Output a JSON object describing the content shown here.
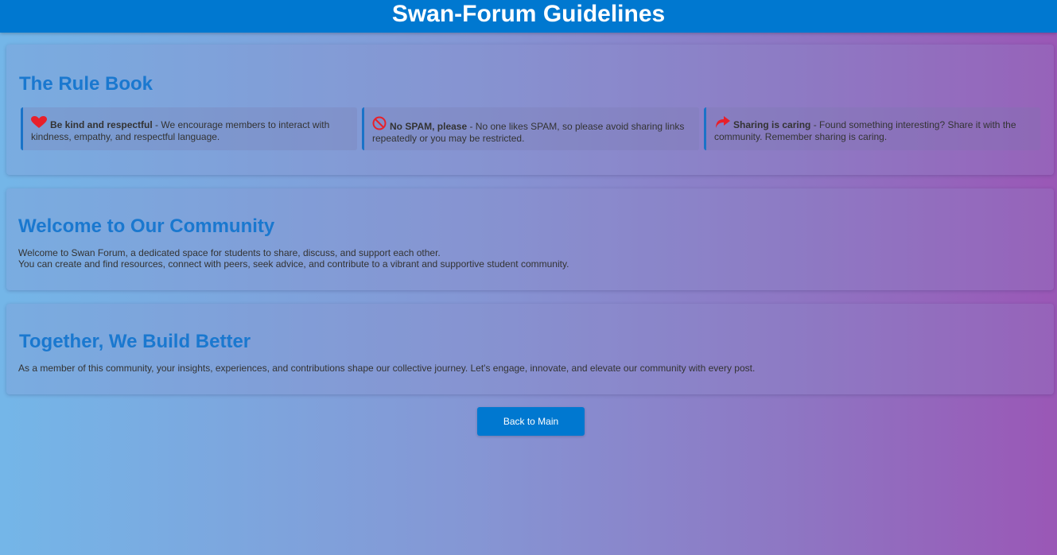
{
  "header": {
    "title": "Swan-Forum Guidelines"
  },
  "rulebook": {
    "title": "The Rule Book",
    "rules": [
      {
        "icon": "heart-icon",
        "title": "Be kind and respectful",
        "text": " - We encourage members to interact with kindness, empathy, and respectful language."
      },
      {
        "icon": "no-entry-icon",
        "title": "No SPAM, please",
        "text": " - No one likes SPAM, so please avoid sharing links repeatedly or you may be restricted."
      },
      {
        "icon": "share-arrow-icon",
        "title": "Sharing is caring",
        "text": " - Found something interesting? Share it with the community. Remember sharing is caring."
      }
    ]
  },
  "welcome": {
    "title": "Welcome to Our Community",
    "line1": "Welcome to Swan Forum, a dedicated space for students to share, discuss, and support each other.",
    "line2": "You can create and find resources, connect with peers, seek advice, and contribute to a vibrant and supportive student community."
  },
  "together": {
    "title": "Together, We Build Better",
    "text": "As a member of this community, your insights, experiences, and contributions shape our collective journey. Let's engage, innovate, and elevate our community with every post."
  },
  "back_button": {
    "label": "Back to Main"
  },
  "colors": {
    "accent": "#0078d0",
    "heading": "#1a78cf",
    "icon_red": "#e8202a"
  }
}
